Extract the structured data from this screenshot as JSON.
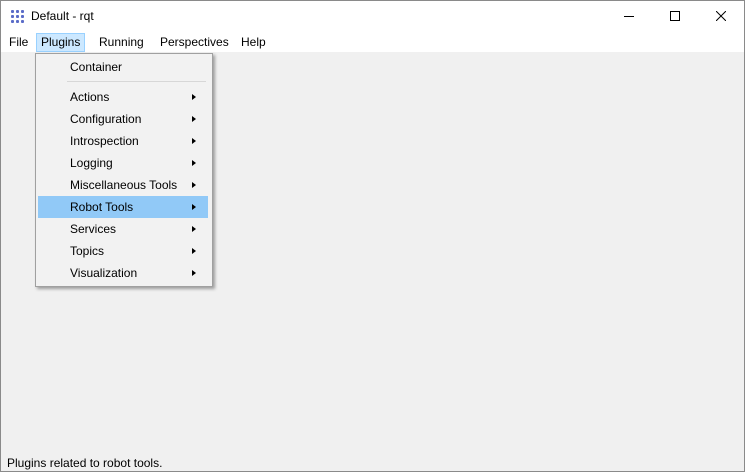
{
  "window": {
    "title": "Default - rqt"
  },
  "menubar": {
    "items": [
      "File",
      "Plugins",
      "Running",
      "Perspectives",
      "Help"
    ]
  },
  "plugins_menu": {
    "top_item": "Container",
    "items": [
      "Actions",
      "Configuration",
      "Introspection",
      "Logging",
      "Miscellaneous Tools",
      "Robot Tools",
      "Services",
      "Topics",
      "Visualization"
    ],
    "highlighted": "Robot Tools"
  },
  "statusbar": {
    "text": "Plugins related to robot tools."
  },
  "colors": {
    "menu_highlight": "#91c9f7",
    "active_menubar": "#cce8ff"
  }
}
